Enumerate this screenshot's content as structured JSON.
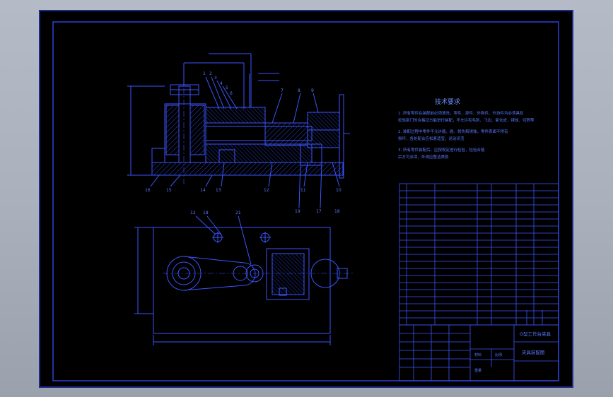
{
  "tech_requirements": {
    "title": "技术要求",
    "lines": [
      "1. 所有零件在装配前必须清洗，零件、部件、外购件、外协件均必须具有",
      "检验部门的合格证方能进行装配，不允许有毛刺、飞边、氧化皮、锈蚀、切屑等",
      "2. 装配过程中零件不允许磕、碰、划伤和锈蚀，零件表面不得有",
      "损坏，各处配合应松紧适宜，运动灵活",
      "3. 所有零件装配后，应按规定进行检验，检验合格",
      "后方可涂漆，外观应整洁美观"
    ]
  },
  "balloons_top": [
    "1",
    "2",
    "3",
    "4",
    "5",
    "6",
    "7",
    "8",
    "9"
  ],
  "balloons_bottom": [
    "16",
    "15",
    "14",
    "13",
    "12",
    "11",
    "10",
    "19",
    "17",
    "18"
  ],
  "balloons_plan": [
    "12",
    "18",
    "21"
  ],
  "title_block": {
    "drawing_title": "G型工作台夹具",
    "drawing_name": "夹具装配图",
    "label_a": "材料",
    "label_b": "比例",
    "label_c": "重量"
  },
  "colors": {
    "line": "#3a55ff",
    "text": "#5a78ff",
    "border": "#2d46e8",
    "background": "#000000"
  }
}
